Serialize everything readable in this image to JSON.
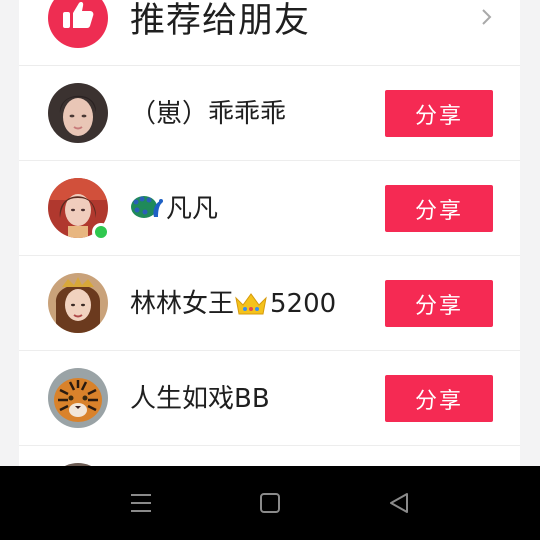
{
  "header": {
    "title": "推荐给朋友",
    "badge_icon": "thumbs-up-icon",
    "arrow_icon": "chevron-right-icon"
  },
  "contacts": [
    {
      "name": "（崽）乖乖乖",
      "share_label": "分享",
      "online": false
    },
    {
      "name_prefix_icon": "peacock-emoji",
      "name": "凡凡",
      "share_label": "分享",
      "online": true
    },
    {
      "name": "林林女王",
      "name_inline_icon": "crown-emoji",
      "name_suffix": "5200",
      "share_label": "分享",
      "online": false
    },
    {
      "name": "人生如戏BB",
      "share_label": "分享",
      "online": false
    }
  ],
  "navbar": {
    "buttons": [
      "menu-icon",
      "home-square-icon",
      "back-triangle-icon"
    ]
  },
  "colors": {
    "accent": "#f52a53",
    "badge": "#ee2d52",
    "online": "#2fc84f",
    "navbar": "#000000"
  }
}
